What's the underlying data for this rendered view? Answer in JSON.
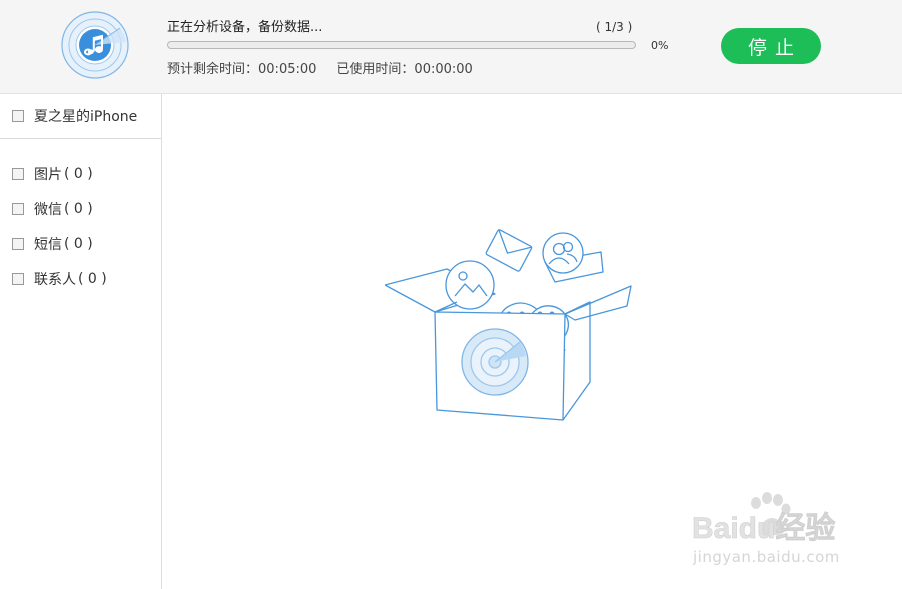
{
  "header": {
    "status_text": "正在分析设备，备份数据...",
    "step_counter": "( 1/3 )",
    "progress_percent": 0,
    "progress_label": "0%",
    "remaining_label": "预计剩余时间：",
    "remaining_value": "00:05:00",
    "elapsed_label": "已使用时间：",
    "elapsed_value": "00:00:00",
    "stop_label": "停止"
  },
  "sidebar": {
    "device_name": "夏之星的iPhone",
    "categories": [
      {
        "label": "图片",
        "count": "( 0 )"
      },
      {
        "label": "微信",
        "count": "( 0 )"
      },
      {
        "label": "短信",
        "count": "( 0 )"
      },
      {
        "label": "联系人",
        "count": "( 0 )"
      }
    ]
  },
  "watermark": {
    "brand": "Baidu经验",
    "url": "jingyan.baidu.com"
  },
  "colors": {
    "accent_blue": "#3a8fdc",
    "stop_green": "#1dbd57",
    "header_bg": "#f5f5f5"
  },
  "icons": {
    "logo": "music-radar-icon",
    "box": "open-box-illustration"
  }
}
